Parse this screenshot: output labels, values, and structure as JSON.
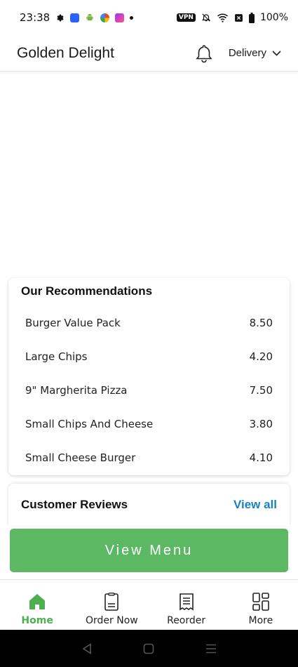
{
  "status_bar": {
    "time": "23:38",
    "vpn": "VPN",
    "battery": "100%"
  },
  "header": {
    "title": "Golden Delight",
    "delivery_label": "Delivery"
  },
  "recommendations": {
    "title": "Our Recommendations",
    "items": [
      {
        "name": "Burger Value Pack",
        "price": "8.50"
      },
      {
        "name": "Large Chips",
        "price": "4.20"
      },
      {
        "name": "9\" Margherita Pizza",
        "price": "7.50"
      },
      {
        "name": "Small Chips And Cheese",
        "price": "3.80"
      },
      {
        "name": "Small Cheese Burger",
        "price": "4.10"
      }
    ]
  },
  "reviews": {
    "title": "Customer Reviews",
    "view_all": "View all"
  },
  "view_menu_label": "View Menu",
  "bottom_nav": {
    "items": [
      {
        "label": "Home",
        "icon": "home-icon",
        "active": true
      },
      {
        "label": "Order Now",
        "icon": "order-icon",
        "active": false
      },
      {
        "label": "Reorder",
        "icon": "receipt-icon",
        "active": false
      },
      {
        "label": "More",
        "icon": "grid-icon",
        "active": false
      }
    ]
  },
  "colors": {
    "accent_green": "#5cb862",
    "link_blue": "#1a82c4",
    "active_nav": "#4caf50"
  }
}
